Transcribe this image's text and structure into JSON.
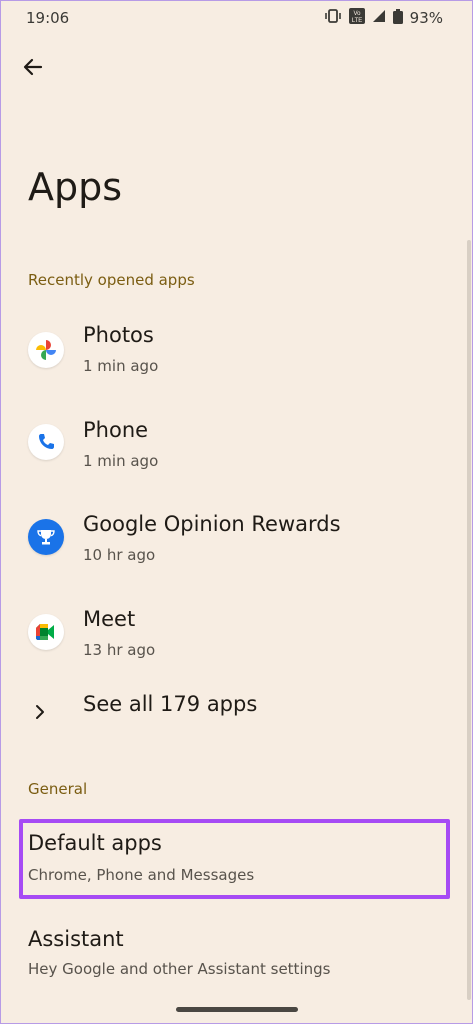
{
  "status": {
    "time": "19:06",
    "battery": "93%",
    "volte": "VoLTE",
    "icons": [
      "vibrate-icon",
      "volte-icon",
      "signal-icon",
      "battery-icon"
    ]
  },
  "header": {
    "title": "Apps"
  },
  "recent": {
    "section_label": "Recently opened apps",
    "apps": [
      {
        "name": "Photos",
        "time": "1 min ago",
        "icon": "photos-icon"
      },
      {
        "name": "Phone",
        "time": "1 min ago",
        "icon": "phone-icon"
      },
      {
        "name": "Google Opinion Rewards",
        "time": "10 hr ago",
        "icon": "opinion-rewards-icon"
      },
      {
        "name": "Meet",
        "time": "13 hr ago",
        "icon": "meet-icon"
      }
    ],
    "see_all_label": "See all 179 apps"
  },
  "general": {
    "section_label": "General",
    "items": [
      {
        "name": "Default apps",
        "desc": "Chrome, Phone and Messages"
      },
      {
        "name": "Assistant",
        "desc": "Hey Google and other Assistant settings"
      }
    ]
  },
  "colors": {
    "background": "#f7ede2",
    "section_label": "#7b5d12",
    "highlight": "#a64bf4"
  }
}
